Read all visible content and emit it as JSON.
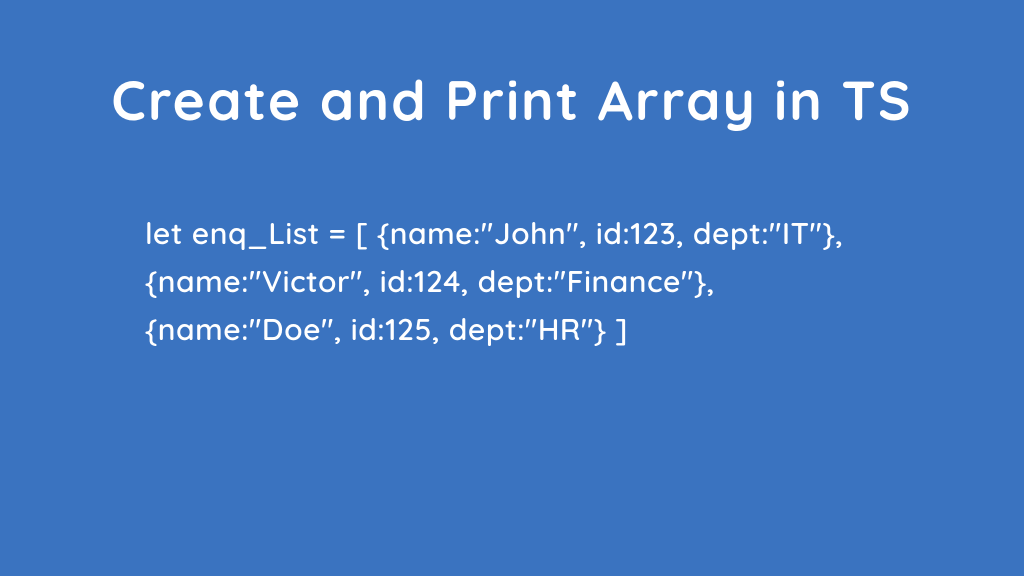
{
  "title": "Create and Print Array in TS",
  "code": " let enq_List = [ {name:\"John\", id:123, dept:\"IT\"}, {name:\"Victor\", id:124, dept:\"Finance\"}, {name:\"Doe\", id:125, dept:\"HR\"} ]"
}
